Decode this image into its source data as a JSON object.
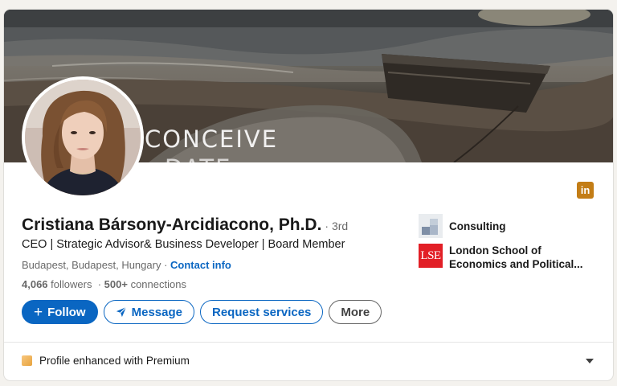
{
  "banner": {
    "text_line1": "CONCEIVE",
    "text_line2": "DATE"
  },
  "profile": {
    "name": "Cristiana Bársony-Arcidiacono, Ph.D.",
    "degree": "· 3rd",
    "headline": "CEO | Strategic Advisor& Business Developer | Board Member",
    "location": "Budapest, Budapest, Hungary",
    "location_separator": " · ",
    "contact_label": "Contact info",
    "followers": "4,066",
    "followers_label": "followers",
    "connections": "500+",
    "connections_label": "connections"
  },
  "badge": {
    "label": "in"
  },
  "actions": {
    "follow_label": "Follow",
    "message_label": "Message",
    "request_label": "Request services",
    "more_label": "More"
  },
  "side": {
    "company_name": "Consulting",
    "school_name_line1": "London School of",
    "school_name_line2": "Economics and Political...",
    "school_logo_text": "LSE"
  },
  "premium": {
    "label": "Profile enhanced with Premium"
  },
  "colors": {
    "brand": "#0a66c2",
    "premium": "#e7a33e",
    "lse_red": "#e21f26"
  }
}
